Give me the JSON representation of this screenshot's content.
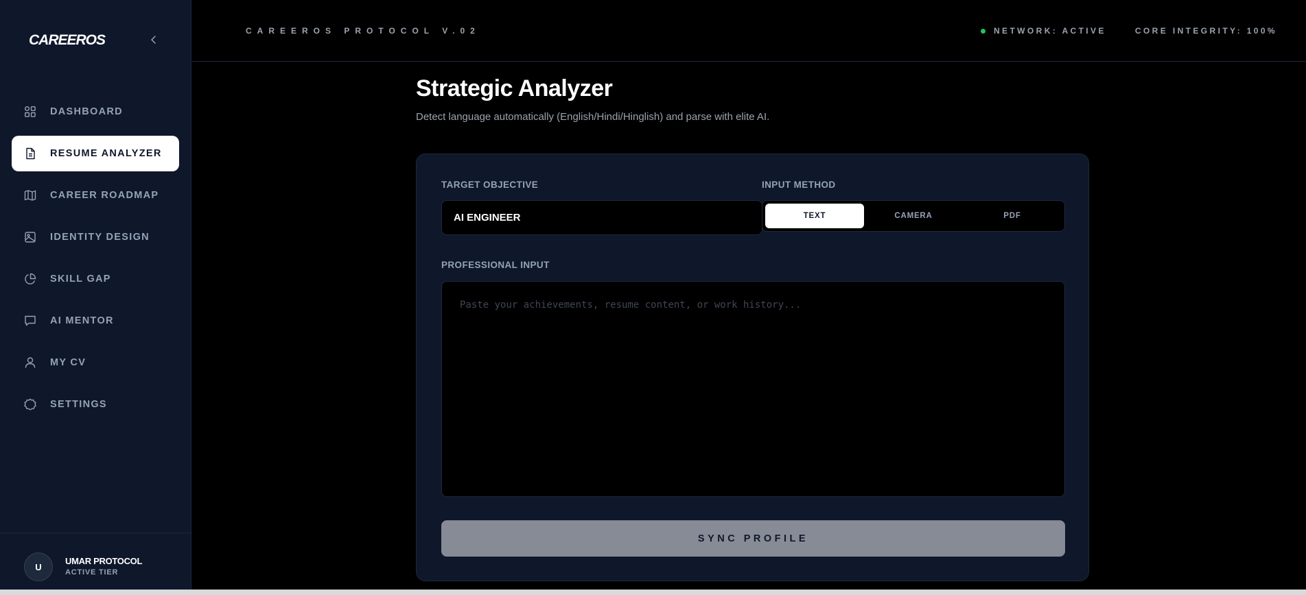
{
  "brand": "CAREEROS",
  "sidebar": {
    "items": [
      {
        "label": "DASHBOARD",
        "icon": "grid-icon"
      },
      {
        "label": "RESUME ANALYZER",
        "icon": "document-icon",
        "active": true
      },
      {
        "label": "CAREER ROADMAP",
        "icon": "map-icon"
      },
      {
        "label": "IDENTITY DESIGN",
        "icon": "image-icon"
      },
      {
        "label": "SKILL GAP",
        "icon": "pie-chart-icon"
      },
      {
        "label": "AI MENTOR",
        "icon": "chat-icon"
      },
      {
        "label": "MY CV",
        "icon": "user-icon"
      },
      {
        "label": "SETTINGS",
        "icon": "gear-icon"
      }
    ],
    "user": {
      "initial": "U",
      "name": "UMAR PROTOCOL",
      "tier": "ACTIVE TIER"
    }
  },
  "topbar": {
    "protocol": "CAREEROS PROTOCOL V.02",
    "network": "NETWORK: ACTIVE",
    "integrity": "CORE INTEGRITY: 100%"
  },
  "main": {
    "title": "Strategic Analyzer",
    "subtitle": "Detect language automatically (English/Hindi/Hinglish) and parse with elite AI.",
    "target_label": "TARGET OBJECTIVE",
    "target_value": "AI ENGINEER",
    "method_label": "INPUT METHOD",
    "methods": [
      "TEXT",
      "CAMERA",
      "PDF"
    ],
    "active_method": "TEXT",
    "professional_label": "PROFESSIONAL INPUT",
    "professional_placeholder": "Paste your achievements, resume content, or work history...",
    "sync_button": "SYNC PROFILE"
  },
  "colors": {
    "sidebar_bg": "#0f172a",
    "card_bg": "#0f172a",
    "accent_active": "#ffffff",
    "status_green": "#22c55e",
    "sync_button_bg": "#868b96"
  }
}
